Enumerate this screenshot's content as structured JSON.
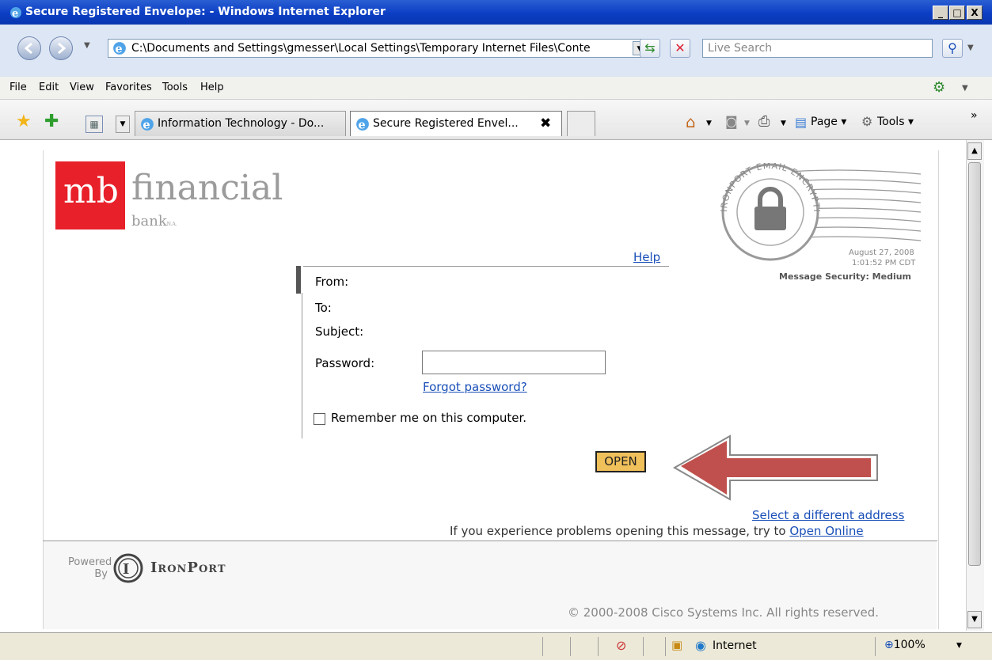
{
  "window": {
    "title": "Secure Registered Envelope: - Windows Internet Explorer",
    "min": "_",
    "max": "□",
    "close": "X"
  },
  "address": {
    "url": "C:\\Documents and Settings\\gmesser\\Local Settings\\Temporary Internet Files\\Conte",
    "search_placeholder": "Live Search"
  },
  "menu": [
    "File",
    "Edit",
    "View",
    "Favorites",
    "Tools",
    "Help"
  ],
  "tabs": [
    {
      "label": "Information Technology - Do..."
    },
    {
      "label": "Secure Registered Envel..."
    }
  ],
  "command_bar": {
    "page_label": "Page",
    "tools_label": "Tools"
  },
  "page": {
    "logo": {
      "mb": "mb",
      "financial": "financial",
      "bank": "bank",
      "na": "N.A."
    },
    "stamp": {
      "ring_text": "IRONPORT EMAIL ENCRYPTION",
      "date": "August 27, 2008",
      "time": "1:01:52 PM CDT",
      "security": "Message Security: Medium"
    },
    "help_link": "Help",
    "from_label": "From:",
    "to_label": "To:",
    "subject_label": "Subject:",
    "password_label": "Password:",
    "forgot_password": "Forgot password?",
    "remember_me": "Remember me on this computer.",
    "open_button": "OPEN",
    "select_address": "Select a different address",
    "problems_text": "If you experience problems opening this message, try to",
    "open_online": "Open Online",
    "powered": "Powered",
    "by": "By",
    "ironport": "IronPort",
    "copyright": "© 2000-2008 Cisco Systems Inc. All rights reserved."
  },
  "status": {
    "zone": "Internet",
    "zoom": "100%"
  },
  "colors": {
    "title_bar": "#0b3ec4",
    "logo_red": "#e8202a",
    "open_button": "#f0c05a",
    "arrow": "#c0504d",
    "link": "#1a4fb8"
  }
}
